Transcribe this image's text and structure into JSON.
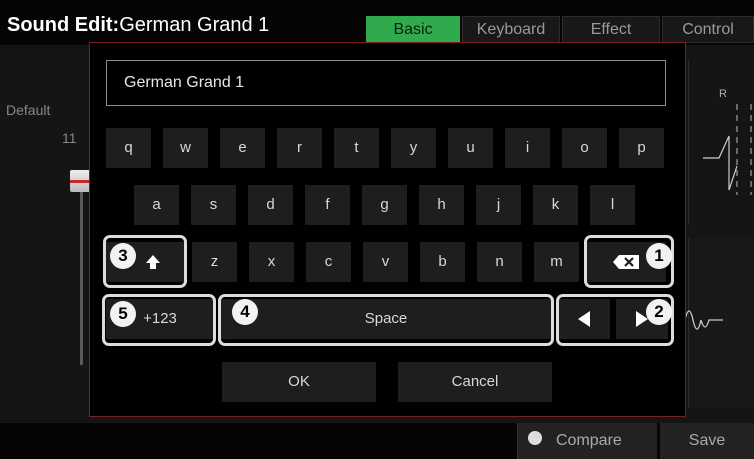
{
  "header": {
    "title_bold": "Sound Edit:",
    "title_value": "German Grand 1",
    "tabs": [
      {
        "label": "Basic"
      },
      {
        "label": "Keyboard"
      },
      {
        "label": "Effect"
      },
      {
        "label": "Control"
      }
    ]
  },
  "background": {
    "left_label": "Default",
    "left_value": "11",
    "right_marker": "R"
  },
  "dialog": {
    "name_value": "German Grand 1",
    "rows": [
      [
        "q",
        "w",
        "e",
        "r",
        "t",
        "y",
        "u",
        "i",
        "o",
        "p"
      ],
      [
        "a",
        "s",
        "d",
        "f",
        "g",
        "h",
        "j",
        "k",
        "l"
      ],
      [
        "z",
        "x",
        "c",
        "v",
        "b",
        "n",
        "m"
      ]
    ],
    "shift_icon": "shift-up-arrow-icon",
    "backspace_icon": "backspace-icon",
    "mode_label": "+123",
    "space_label": "Space",
    "left_icon": "cursor-left-icon",
    "right_icon": "cursor-right-icon",
    "ok_label": "OK",
    "cancel_label": "Cancel"
  },
  "callouts": [
    "1",
    "2",
    "3",
    "4",
    "5"
  ],
  "footer": {
    "compare_label": "Compare",
    "save_label": "Save"
  },
  "colors": {
    "accent_tab": "#2faa4c",
    "dialog_border": "#7a1f1f",
    "callout": "#f2f2f2"
  }
}
